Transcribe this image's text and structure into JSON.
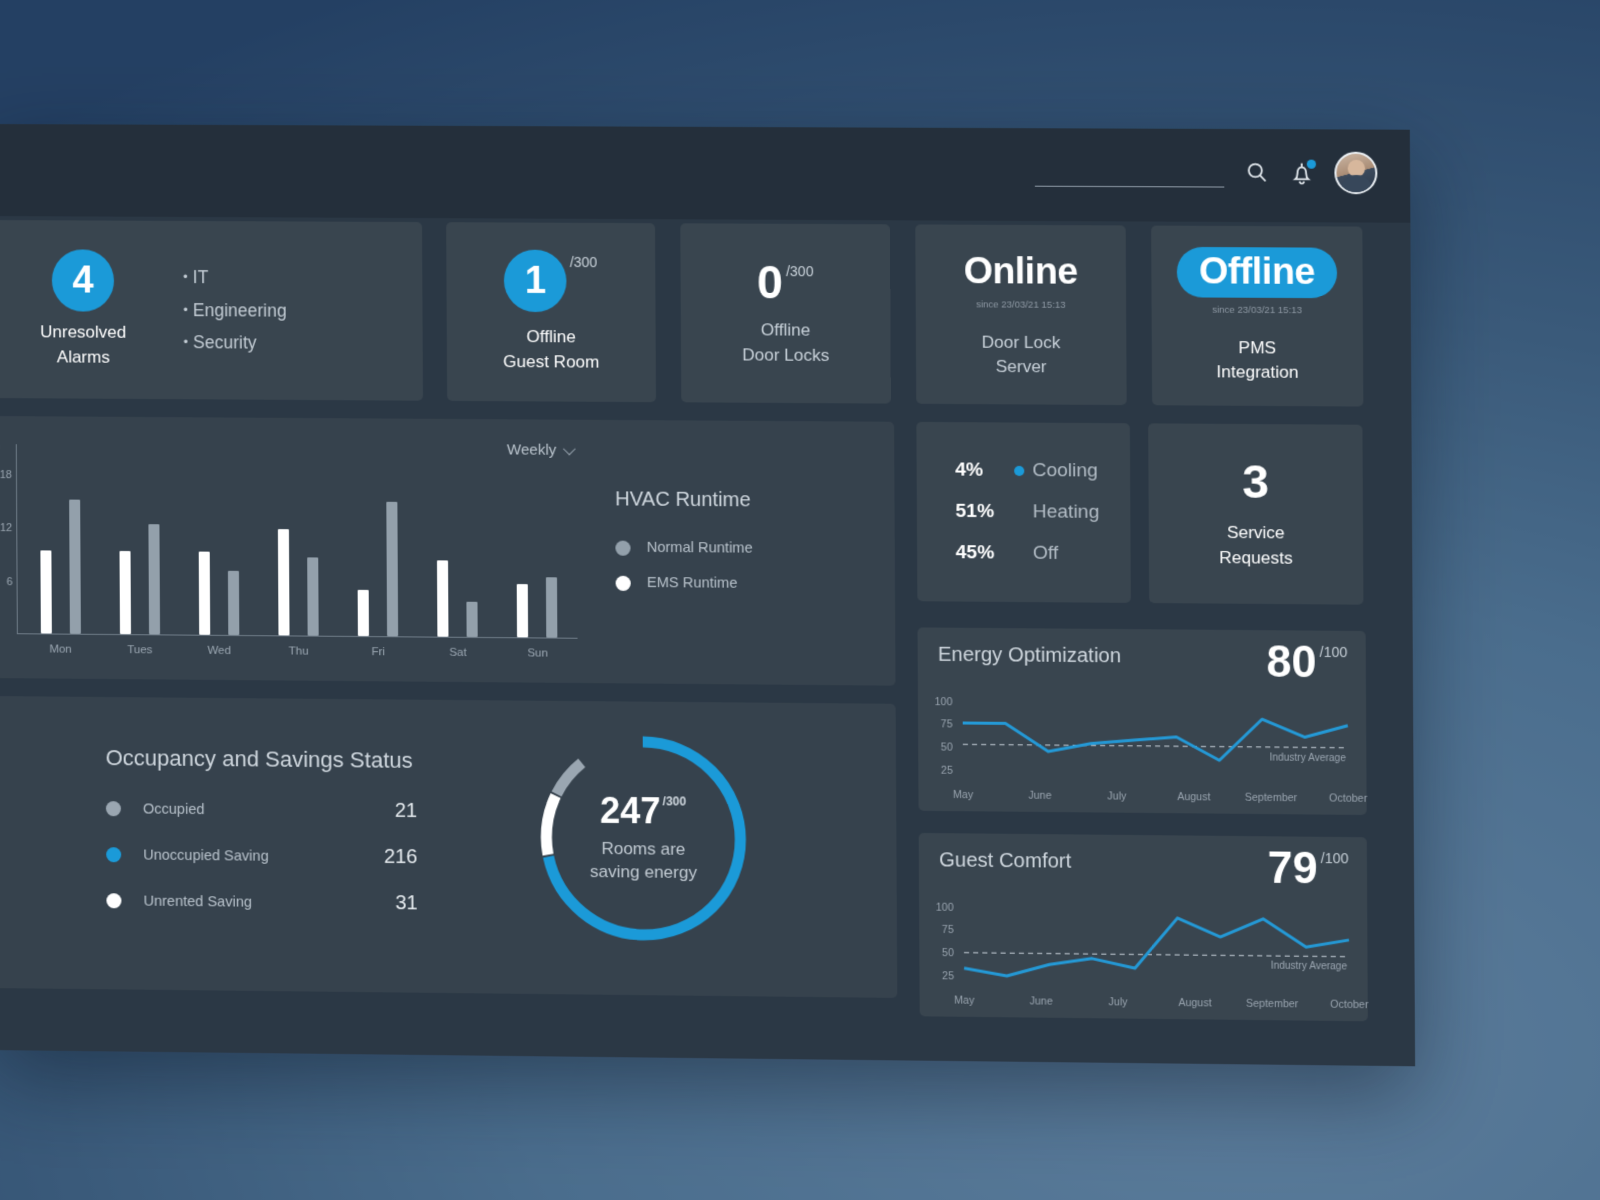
{
  "header": {
    "search_placeholder": "",
    "search_value": "",
    "search_icon": "search-icon",
    "bell_icon": "notification-bell-icon",
    "avatar_label": "User avatar"
  },
  "kpi": {
    "alarms": {
      "count": "4",
      "caption": "Unresolved\nAlarms",
      "caption_line1": "Unresolved",
      "caption_line2": "Alarms",
      "categories": [
        "IT",
        "Engineering",
        "Security"
      ]
    },
    "guest_room": {
      "value": "1",
      "total": "/300",
      "label_line1": "Offline",
      "label_line2": "Guest Room"
    },
    "door_locks": {
      "value": "0",
      "total": "/300",
      "label_line1": "Offline",
      "label_line2": "Door Locks"
    },
    "door_lock_server": {
      "status": "Online",
      "since": "since 23/03/21 15:13",
      "label_line1": "Door Lock",
      "label_line2": "Server"
    },
    "pms_integration": {
      "status": "Offline",
      "since": "since 23/03/21 15:13",
      "label_line1": "PMS",
      "label_line2": "Integration"
    }
  },
  "hvac": {
    "title": "HVAC Runtime",
    "range_selector": "Weekly",
    "legend": [
      {
        "label": "Normal Runtime",
        "color": "#93a0ab"
      },
      {
        "label": "EMS Runtime",
        "color": "#ffffff"
      }
    ],
    "modes": [
      {
        "pct": "4%",
        "name": "Cooling",
        "dot": true
      },
      {
        "pct": "51%",
        "name": "Heating",
        "dot": false
      },
      {
        "pct": "45%",
        "name": "Off",
        "dot": false
      }
    ]
  },
  "service_requests": {
    "value": "3",
    "label_line1": "Service",
    "label_line2": "Requests"
  },
  "occupancy": {
    "title": "Occupancy and Savings Status",
    "rows": [
      {
        "name": "Occupied",
        "value": "21",
        "color": "#9aa6b1"
      },
      {
        "name": "Unoccupied Saving",
        "value": "216",
        "color": "#1b9ad8"
      },
      {
        "name": "Unrented Saving",
        "value": "31",
        "color": "#ffffff"
      }
    ],
    "donut_value": "247",
    "donut_total": "/300",
    "donut_caption_line1": "Rooms are",
    "donut_caption_line2": "saving energy"
  },
  "scores": {
    "energy": {
      "title": "Energy Optimization",
      "value": "80",
      "total": "/100"
    },
    "comfort": {
      "title": "Guest Comfort",
      "value": "79",
      "total": "/100"
    }
  },
  "chart_data": [
    {
      "type": "bar",
      "title": "HVAC Runtime",
      "xlabel": "",
      "ylabel": "h",
      "ylim": [
        0,
        22
      ],
      "yticks": [
        6,
        12,
        18
      ],
      "grid": false,
      "legend_position": "right",
      "categories": [
        "Mon",
        "Tues",
        "Wed",
        "Thu",
        "Fri",
        "Sat",
        "Sun"
      ],
      "series": [
        {
          "name": "EMS Runtime",
          "color": "#ffffff",
          "values": [
            9.3,
            9.3,
            9.3,
            11.9,
            5.2,
            8.5,
            5.9
          ]
        },
        {
          "name": "Normal Runtime",
          "color": "#93a0ab",
          "values": [
            15.0,
            12.3,
            7.2,
            8.8,
            15.0,
            3.9,
            6.7
          ]
        }
      ]
    },
    {
      "type": "pie",
      "title": "HVAC Mode Distribution",
      "labels": [
        "Cooling",
        "Heating",
        "Off"
      ],
      "values": [
        4,
        51,
        45
      ],
      "unit": "%"
    },
    {
      "type": "pie",
      "title": "Occupancy and Savings Status",
      "subtitle": "247 /300 Rooms are saving energy",
      "labels": [
        "Unoccupied Saving",
        "Unrented Saving",
        "Occupied"
      ],
      "values": [
        216,
        31,
        21
      ],
      "colors": [
        "#1b9ad8",
        "#ffffff",
        "#9aa6b1"
      ],
      "total": 300
    },
    {
      "type": "line",
      "title": "Energy Optimization",
      "score": 80,
      "score_max": 100,
      "ylim": [
        25,
        100
      ],
      "yticks": [
        25,
        50,
        75,
        100
      ],
      "x": [
        "May",
        "June",
        "July",
        "August",
        "September",
        "October"
      ],
      "series": [
        {
          "name": "Energy Optimization",
          "color": "#2499d6",
          "values": [
            78,
            78,
            48,
            57,
            61,
            65,
            40,
            85,
            66,
            79
          ]
        }
      ],
      "annotations": [
        {
          "label": "Industry Average",
          "y": 55,
          "style": "dashed"
        }
      ]
    },
    {
      "type": "line",
      "title": "Guest Comfort",
      "score": 79,
      "score_max": 100,
      "ylim": [
        25,
        100
      ],
      "yticks": [
        25,
        50,
        75,
        100
      ],
      "x": [
        "May",
        "June",
        "July",
        "August",
        "September",
        "October"
      ],
      "series": [
        {
          "name": "Guest Comfort",
          "color": "#2499d6",
          "values": [
            35,
            27,
            40,
            47,
            37,
            92,
            72,
            92,
            62,
            70
          ]
        }
      ],
      "annotations": [
        {
          "label": "Industry Average",
          "y": 52,
          "style": "dashed"
        }
      ]
    }
  ]
}
